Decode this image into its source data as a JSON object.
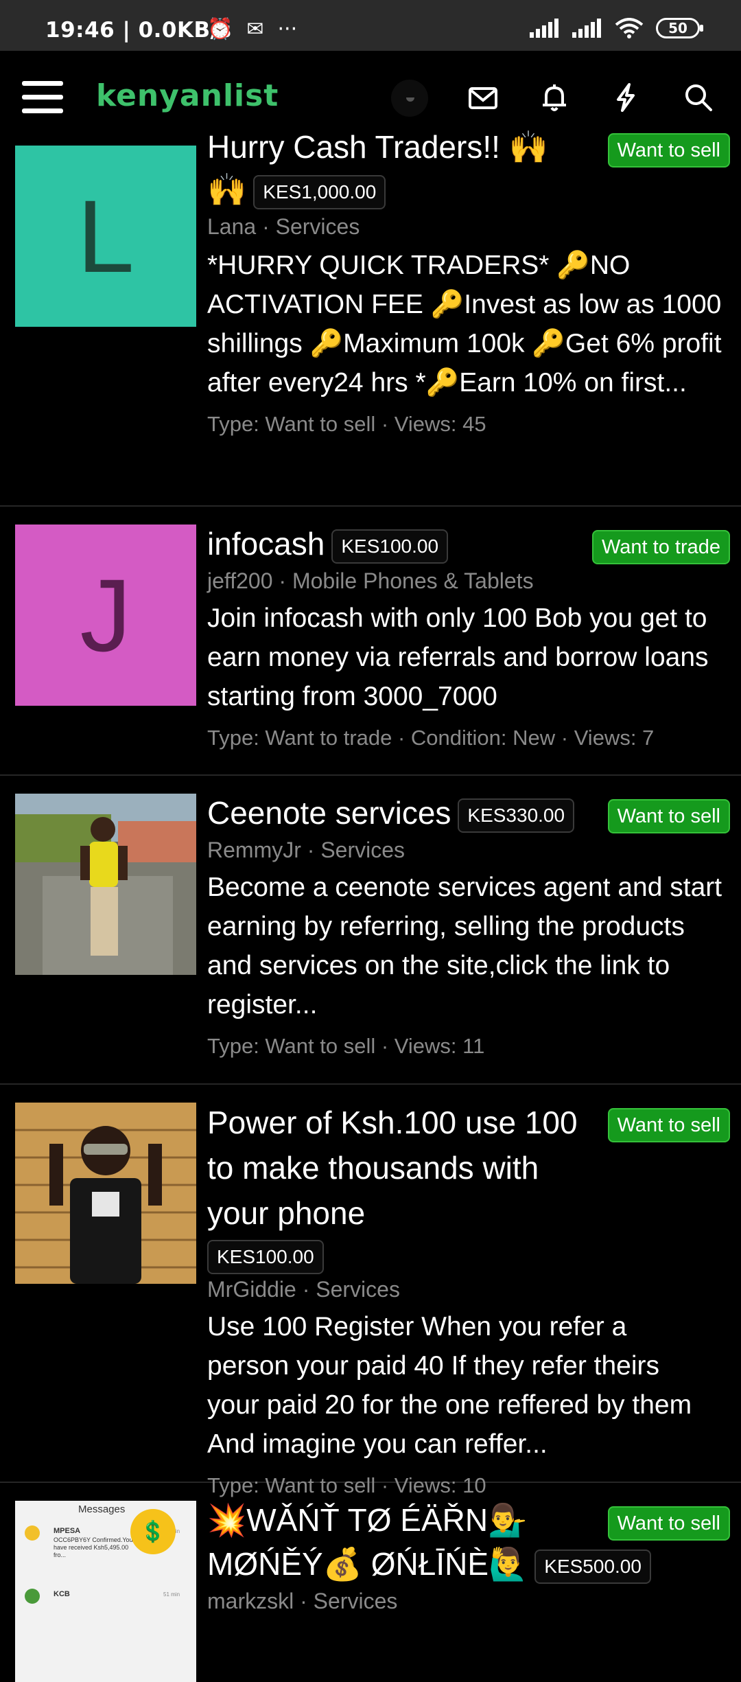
{
  "status_bar": {
    "time_speed": "19:46 | 0.0KB/s",
    "alarm_icon": "alarm-clock-icon",
    "sticker_icon": "notification-icon",
    "more": "···",
    "battery": "50"
  },
  "app_bar": {
    "logo": "kenyanlist",
    "icons": [
      "menu-icon",
      "mail-icon",
      "bell-icon",
      "lightning-icon",
      "search-icon"
    ]
  },
  "listings": [
    {
      "title_line1": "Hurry Cash Traders!! 🙌",
      "title_line2": "🙌",
      "price": "KES1,000.00",
      "badge": "Want to sell",
      "meta": "Lana · Services",
      "desc": "*HURRY QUICK TRADERS* 🔑NO ACTIVATION FEE 🔑Invest as low as 1000 shillings 🔑Maximum 100k 🔑Get 6% profit after every24 hrs *🔑Earn 10% on first...",
      "stats": "Type: Want to sell · Views: 45",
      "thumb_letter": "L",
      "thumb_color": "#2ec4a4",
      "letter_color": "#1c4a3c"
    },
    {
      "title": "infocash",
      "price": "KES100.00",
      "badge": "Want to trade",
      "meta": "jeff200 · Mobile Phones & Tablets",
      "desc": "Join infocash with only 100 Bob you get to earn money via referrals and borrow loans starting from 3000_7000",
      "stats": "Type: Want to trade · Condition: New · Views: 7",
      "thumb_letter": "J",
      "thumb_color": "#d45bc4",
      "letter_color": "#5a1e50"
    },
    {
      "title": "Ceenote services",
      "price": "KES330.00",
      "badge": "Want to sell",
      "meta": "RemmyJr · Services",
      "desc": "Become a ceenote services agent and start earning by referring, selling the products and services on the site,click the link to register...",
      "stats": "Type: Want to sell · Views: 11"
    },
    {
      "title": "Power of Ksh.100 use 100 to make thousands with your phone",
      "price": "KES100.00",
      "badge": "Want to sell",
      "meta": "MrGiddie · Services",
      "desc": "Use 100 Register When you refer a person your paid 40 If they refer theirs your paid 20 for the one reffered by them And imagine you can reffer...",
      "stats": "Type: Want to sell · Views: 10"
    },
    {
      "title_line1": "💥WǍŃŤ TØ ÉÄŘN💁‍♂️",
      "title_line2": "MØŃĚÝ💰 ØŃŁĪŃÈ🙋‍♂️",
      "price": "KES500.00",
      "badge": "Want to sell",
      "meta": "markzskl · Services",
      "thumb_texts": {
        "header": "Messages",
        "mpesa": "MPESA",
        "mpesa_msg": "OCC6PBY6Y Confirmed.You have received Ksh5,495.00 fro...",
        "time1": "51 min",
        "kcb": "KCB",
        "time2": "51 min"
      }
    }
  ]
}
